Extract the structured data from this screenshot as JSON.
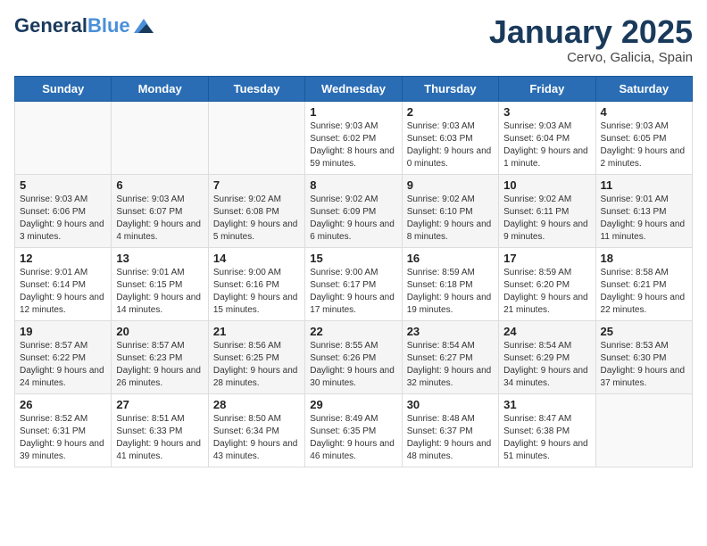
{
  "header": {
    "logo_general": "General",
    "logo_blue": "Blue",
    "title": "January 2025",
    "subtitle": "Cervo, Galicia, Spain"
  },
  "weekdays": [
    "Sunday",
    "Monday",
    "Tuesday",
    "Wednesday",
    "Thursday",
    "Friday",
    "Saturday"
  ],
  "weeks": [
    [
      {
        "day": "",
        "sunrise": "",
        "sunset": "",
        "daylight": "",
        "empty": true
      },
      {
        "day": "",
        "sunrise": "",
        "sunset": "",
        "daylight": "",
        "empty": true
      },
      {
        "day": "",
        "sunrise": "",
        "sunset": "",
        "daylight": "",
        "empty": true
      },
      {
        "day": "1",
        "sunrise": "Sunrise: 9:03 AM",
        "sunset": "Sunset: 6:02 PM",
        "daylight": "Daylight: 8 hours and 59 minutes."
      },
      {
        "day": "2",
        "sunrise": "Sunrise: 9:03 AM",
        "sunset": "Sunset: 6:03 PM",
        "daylight": "Daylight: 9 hours and 0 minutes."
      },
      {
        "day": "3",
        "sunrise": "Sunrise: 9:03 AM",
        "sunset": "Sunset: 6:04 PM",
        "daylight": "Daylight: 9 hours and 1 minute."
      },
      {
        "day": "4",
        "sunrise": "Sunrise: 9:03 AM",
        "sunset": "Sunset: 6:05 PM",
        "daylight": "Daylight: 9 hours and 2 minutes."
      }
    ],
    [
      {
        "day": "5",
        "sunrise": "Sunrise: 9:03 AM",
        "sunset": "Sunset: 6:06 PM",
        "daylight": "Daylight: 9 hours and 3 minutes."
      },
      {
        "day": "6",
        "sunrise": "Sunrise: 9:03 AM",
        "sunset": "Sunset: 6:07 PM",
        "daylight": "Daylight: 9 hours and 4 minutes."
      },
      {
        "day": "7",
        "sunrise": "Sunrise: 9:02 AM",
        "sunset": "Sunset: 6:08 PM",
        "daylight": "Daylight: 9 hours and 5 minutes."
      },
      {
        "day": "8",
        "sunrise": "Sunrise: 9:02 AM",
        "sunset": "Sunset: 6:09 PM",
        "daylight": "Daylight: 9 hours and 6 minutes."
      },
      {
        "day": "9",
        "sunrise": "Sunrise: 9:02 AM",
        "sunset": "Sunset: 6:10 PM",
        "daylight": "Daylight: 9 hours and 8 minutes."
      },
      {
        "day": "10",
        "sunrise": "Sunrise: 9:02 AM",
        "sunset": "Sunset: 6:11 PM",
        "daylight": "Daylight: 9 hours and 9 minutes."
      },
      {
        "day": "11",
        "sunrise": "Sunrise: 9:01 AM",
        "sunset": "Sunset: 6:13 PM",
        "daylight": "Daylight: 9 hours and 11 minutes."
      }
    ],
    [
      {
        "day": "12",
        "sunrise": "Sunrise: 9:01 AM",
        "sunset": "Sunset: 6:14 PM",
        "daylight": "Daylight: 9 hours and 12 minutes."
      },
      {
        "day": "13",
        "sunrise": "Sunrise: 9:01 AM",
        "sunset": "Sunset: 6:15 PM",
        "daylight": "Daylight: 9 hours and 14 minutes."
      },
      {
        "day": "14",
        "sunrise": "Sunrise: 9:00 AM",
        "sunset": "Sunset: 6:16 PM",
        "daylight": "Daylight: 9 hours and 15 minutes."
      },
      {
        "day": "15",
        "sunrise": "Sunrise: 9:00 AM",
        "sunset": "Sunset: 6:17 PM",
        "daylight": "Daylight: 9 hours and 17 minutes."
      },
      {
        "day": "16",
        "sunrise": "Sunrise: 8:59 AM",
        "sunset": "Sunset: 6:18 PM",
        "daylight": "Daylight: 9 hours and 19 minutes."
      },
      {
        "day": "17",
        "sunrise": "Sunrise: 8:59 AM",
        "sunset": "Sunset: 6:20 PM",
        "daylight": "Daylight: 9 hours and 21 minutes."
      },
      {
        "day": "18",
        "sunrise": "Sunrise: 8:58 AM",
        "sunset": "Sunset: 6:21 PM",
        "daylight": "Daylight: 9 hours and 22 minutes."
      }
    ],
    [
      {
        "day": "19",
        "sunrise": "Sunrise: 8:57 AM",
        "sunset": "Sunset: 6:22 PM",
        "daylight": "Daylight: 9 hours and 24 minutes."
      },
      {
        "day": "20",
        "sunrise": "Sunrise: 8:57 AM",
        "sunset": "Sunset: 6:23 PM",
        "daylight": "Daylight: 9 hours and 26 minutes."
      },
      {
        "day": "21",
        "sunrise": "Sunrise: 8:56 AM",
        "sunset": "Sunset: 6:25 PM",
        "daylight": "Daylight: 9 hours and 28 minutes."
      },
      {
        "day": "22",
        "sunrise": "Sunrise: 8:55 AM",
        "sunset": "Sunset: 6:26 PM",
        "daylight": "Daylight: 9 hours and 30 minutes."
      },
      {
        "day": "23",
        "sunrise": "Sunrise: 8:54 AM",
        "sunset": "Sunset: 6:27 PM",
        "daylight": "Daylight: 9 hours and 32 minutes."
      },
      {
        "day": "24",
        "sunrise": "Sunrise: 8:54 AM",
        "sunset": "Sunset: 6:29 PM",
        "daylight": "Daylight: 9 hours and 34 minutes."
      },
      {
        "day": "25",
        "sunrise": "Sunrise: 8:53 AM",
        "sunset": "Sunset: 6:30 PM",
        "daylight": "Daylight: 9 hours and 37 minutes."
      }
    ],
    [
      {
        "day": "26",
        "sunrise": "Sunrise: 8:52 AM",
        "sunset": "Sunset: 6:31 PM",
        "daylight": "Daylight: 9 hours and 39 minutes."
      },
      {
        "day": "27",
        "sunrise": "Sunrise: 8:51 AM",
        "sunset": "Sunset: 6:33 PM",
        "daylight": "Daylight: 9 hours and 41 minutes."
      },
      {
        "day": "28",
        "sunrise": "Sunrise: 8:50 AM",
        "sunset": "Sunset: 6:34 PM",
        "daylight": "Daylight: 9 hours and 43 minutes."
      },
      {
        "day": "29",
        "sunrise": "Sunrise: 8:49 AM",
        "sunset": "Sunset: 6:35 PM",
        "daylight": "Daylight: 9 hours and 46 minutes."
      },
      {
        "day": "30",
        "sunrise": "Sunrise: 8:48 AM",
        "sunset": "Sunset: 6:37 PM",
        "daylight": "Daylight: 9 hours and 48 minutes."
      },
      {
        "day": "31",
        "sunrise": "Sunrise: 8:47 AM",
        "sunset": "Sunset: 6:38 PM",
        "daylight": "Daylight: 9 hours and 51 minutes."
      },
      {
        "day": "",
        "sunrise": "",
        "sunset": "",
        "daylight": "",
        "empty": true
      }
    ]
  ]
}
